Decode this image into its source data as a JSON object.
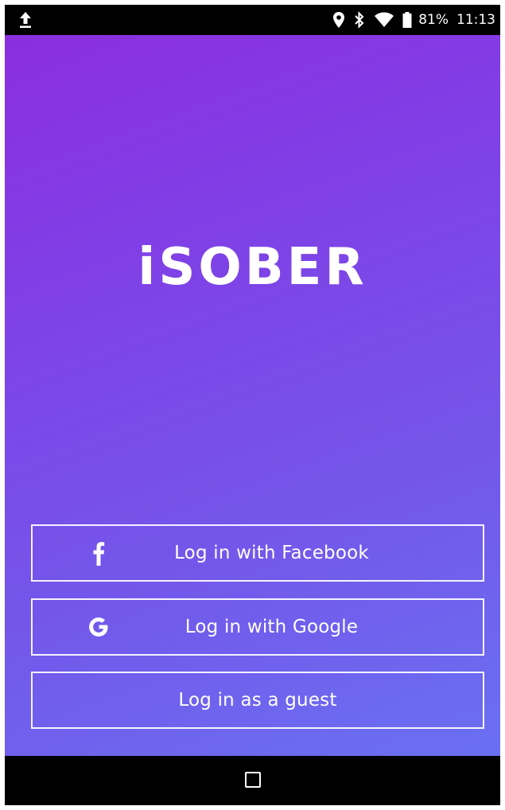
{
  "status_bar": {
    "battery": "81%",
    "time": "11:13",
    "icons": [
      "upload-icon",
      "location-icon",
      "bluetooth-icon",
      "wifi-icon",
      "battery-icon"
    ]
  },
  "app": {
    "logo": "iSOBER",
    "buttons": {
      "facebook": {
        "label": "Log in with Facebook",
        "icon": "facebook-icon"
      },
      "google": {
        "label": "Log in with Google",
        "icon": "google-icon"
      },
      "guest": {
        "label": "Log in as a guest"
      }
    }
  },
  "nav_bar": {
    "icons": [
      "recents-icon"
    ]
  },
  "colors": {
    "gradient_start": "#8b2ee0",
    "gradient_end": "#6a70f2",
    "text": "#ffffff"
  }
}
